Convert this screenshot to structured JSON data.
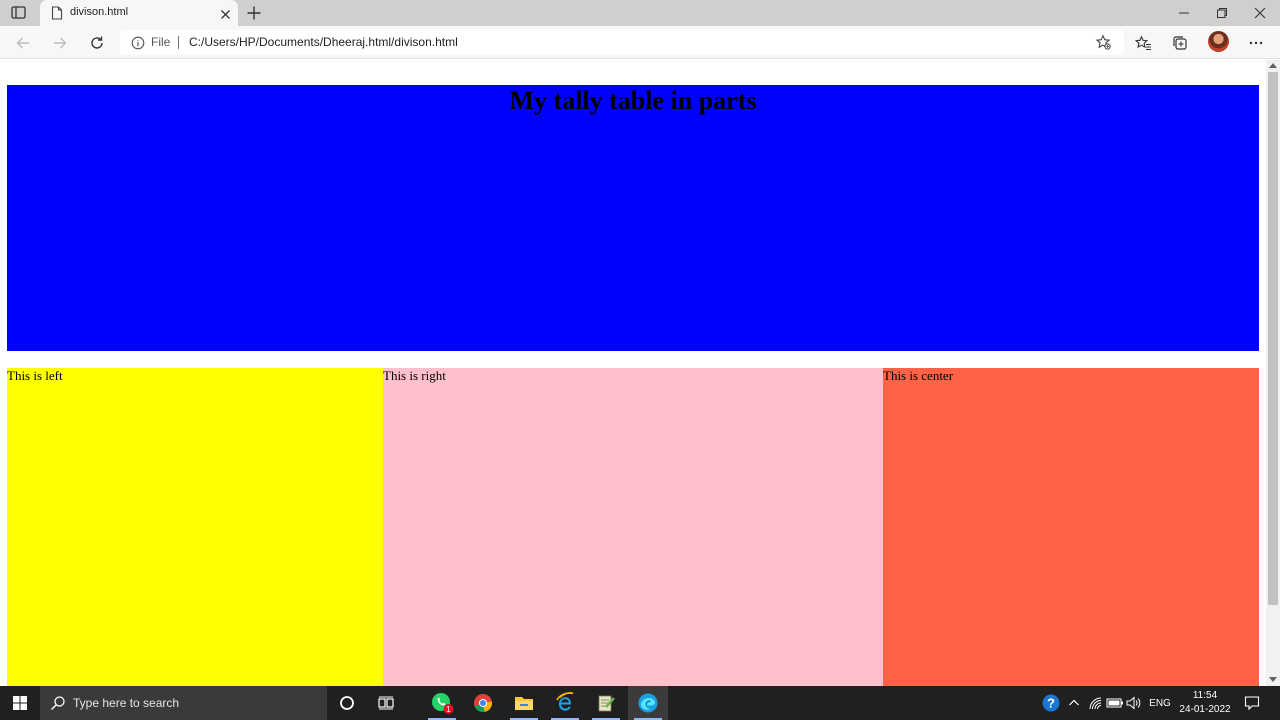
{
  "browser": {
    "tab_title": "divison.html",
    "scheme_label": "File",
    "url": "C:/Users/HP/Documents/Dheeraj.html/divison.html"
  },
  "page": {
    "heading": "My tally table in parts",
    "left_text": "This is left",
    "right_text": "This is right",
    "center_text": "This is center",
    "colors": {
      "header": "#0000ff",
      "left": "#ffff00",
      "right": "#ffc0cb",
      "center": "#ff6347"
    }
  },
  "taskbar": {
    "search_placeholder": "Type here to search",
    "whatsapp_badge": "1",
    "language": "ENG",
    "time": "11:54",
    "date": "24-01-2022"
  }
}
